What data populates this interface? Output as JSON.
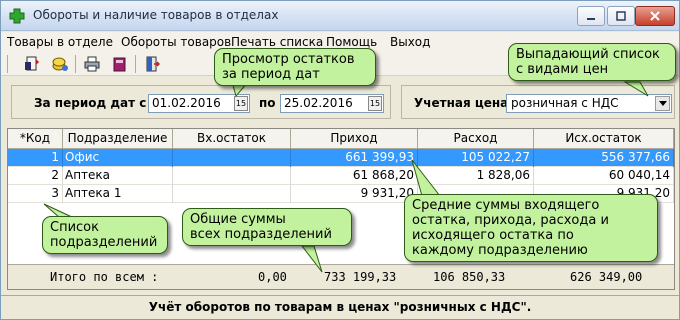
{
  "window": {
    "title": "Обороты и наличие товаров в отделах"
  },
  "menu": {
    "items": [
      "Товары в отделе",
      "Обороты товаров",
      "Печать списка",
      "Помощь",
      "Выход"
    ]
  },
  "toolbar": {
    "icons": [
      "document-add-icon",
      "coins-icon",
      "printer-icon",
      "book-icon",
      "exit-door-icon"
    ]
  },
  "filter": {
    "period_label": "За период дат с",
    "date_from": "01.02.2016",
    "to_label": "по",
    "date_to": "25.02.2016",
    "calendar_btn": "15",
    "price_label": "Учетная цена",
    "price_value": "розничная с НДС"
  },
  "grid": {
    "columns": [
      "*Код",
      "Подразделение",
      "Вх.остаток",
      "Приход",
      "Расход",
      "Исх.остаток"
    ],
    "rows": [
      {
        "code": "1",
        "name": "Офис",
        "opening": "",
        "income": "661 399,93",
        "expense": "105 022,27",
        "closing": "556 377,66",
        "selected": true
      },
      {
        "code": "2",
        "name": "Аптека",
        "opening": "",
        "income": "61 868,20",
        "expense": "1 828,06",
        "closing": "60 040,14",
        "selected": false
      },
      {
        "code": "3",
        "name": "Аптека 1",
        "opening": "",
        "income": "9 931,20",
        "expense": "",
        "closing": "9 931,20",
        "selected": false
      }
    ],
    "total_label": "Итого по всем :",
    "total_opening": "0,00",
    "total_income": "733 199,33",
    "total_expense": "106 850,33",
    "total_closing": "626 349,00"
  },
  "status": {
    "text": "Учёт оборотов по товарам в ценах \"розничных с НДС\"."
  },
  "callouts": {
    "period": "Просмотр остатков\nза период дат",
    "price_list": "Выпадающий список\nс видами цен",
    "departments": "Список\nподразделений",
    "totals": "Общие суммы\nвсех подразделений",
    "averages": "Средние суммы входящего\nостатка, прихода, расхода и\nисходящего остатка по\nкаждому подразделению"
  },
  "colors": {
    "callout_bg": "#c2f29e",
    "selection": "#3399ff"
  }
}
